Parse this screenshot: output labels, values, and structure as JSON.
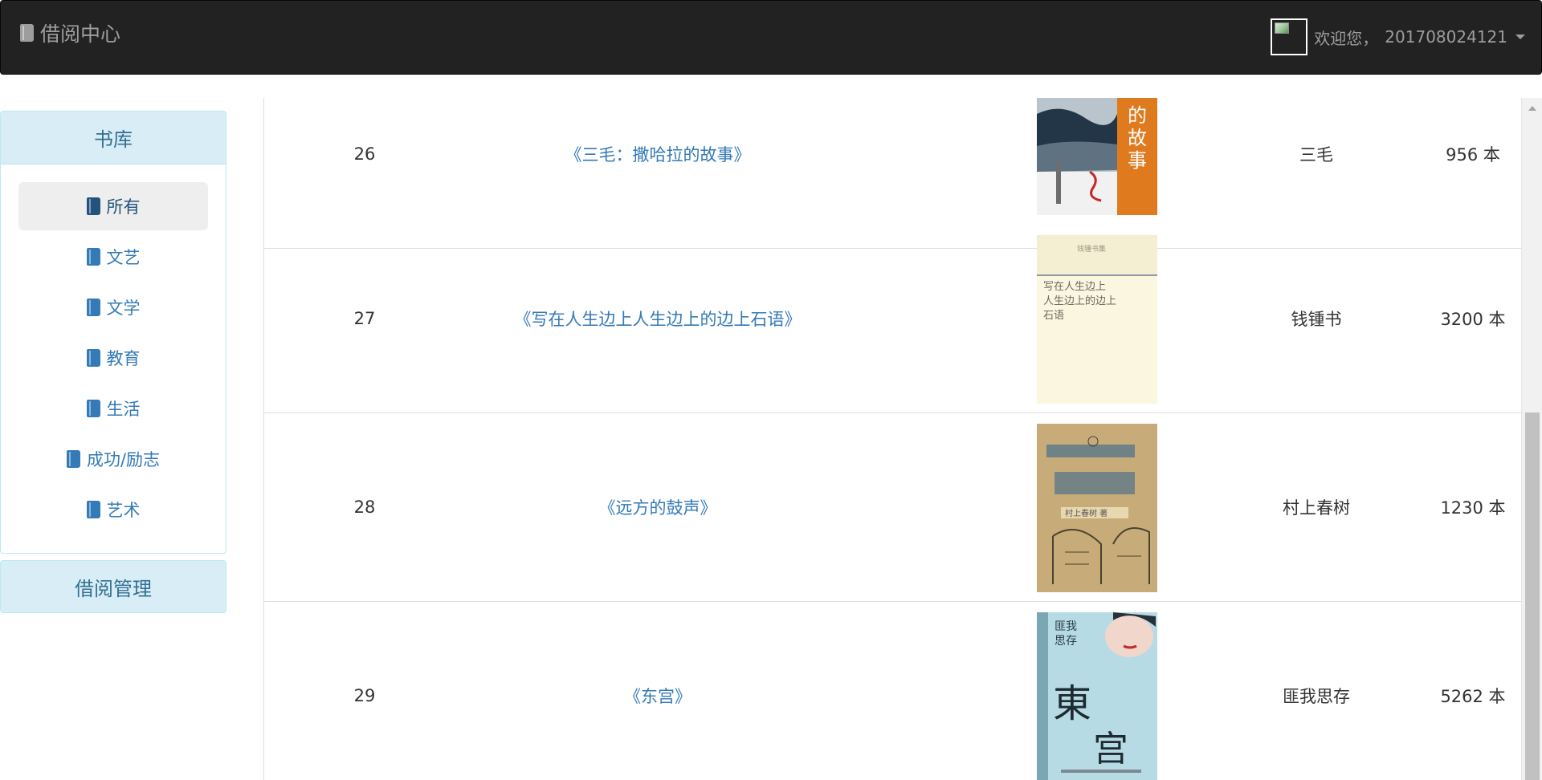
{
  "navbar": {
    "brand": "借阅中心",
    "welcome": "欢迎您，",
    "username": "201708024121"
  },
  "sidebar": {
    "library_heading": "书库",
    "items": [
      {
        "label": "所有",
        "active": true
      },
      {
        "label": "文艺",
        "active": false
      },
      {
        "label": "文学",
        "active": false
      },
      {
        "label": "教育",
        "active": false
      },
      {
        "label": "生活",
        "active": false
      },
      {
        "label": "成功/励志",
        "active": false
      },
      {
        "label": "艺术",
        "active": false
      }
    ],
    "borrow_heading": "借阅管理"
  },
  "books": [
    {
      "id": "26",
      "title": "《三毛：撒哈拉的故事》",
      "author": "三毛",
      "stock": "956 本"
    },
    {
      "id": "27",
      "title": "《写在人生边上人生边上的边上石语》",
      "author": "钱锺书",
      "stock": "3200 本"
    },
    {
      "id": "28",
      "title": "《远方的鼓声》",
      "author": "村上春树",
      "stock": "1230 本"
    },
    {
      "id": "29",
      "title": "《东宫》",
      "author": "匪我思存",
      "stock": "5262 本"
    }
  ],
  "cover_text": {
    "c26": "撒哈拉的故事",
    "c27": "写在人生边上 人生边上的边上 石语",
    "c28": "村上春树 著",
    "c29": "匪我思存"
  },
  "colors": {
    "navbar_bg": "#222222",
    "link": "#337ab7",
    "panel_heading_bg": "#d9edf7",
    "panel_heading_text": "#31708f"
  }
}
